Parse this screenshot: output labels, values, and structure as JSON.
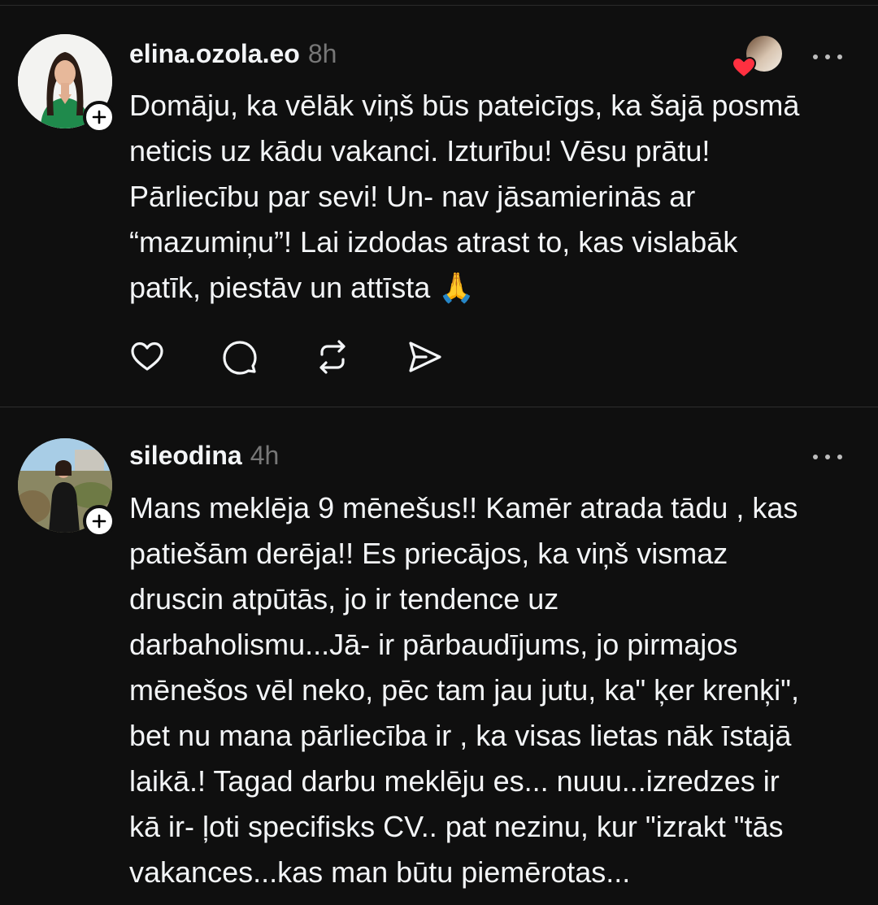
{
  "posts": [
    {
      "username": "elina.ozola.eo",
      "time": "8h",
      "lines": [
        "Domāju, ka vēlāk viņš būs pateicīgs, ka šajā posmā",
        "neticis uz kādu vakanci. Izturību! Vēsu prātu!",
        "Pārliecību par sevi! Un- nav jāsamierinās ar",
        "“mazumiņu”! Lai izdodas atrast to, kas vislabāk",
        "patīk, piestāv un attīsta 🙏"
      ]
    },
    {
      "username": "sileodina",
      "time": "4h",
      "lines": [
        "Mans meklēja 9 mēnešus!! Kamēr atrada tādu , kas",
        "patiešām derēja!! Es priecājos, ka viņš vismaz",
        "druscin atpūtās, jo ir tendence uz",
        "darbaholismu...Jā- ir pārbaudījums, jo pirmajos",
        "mēnešos vēl neko, pēc tam jau jutu, ka\" ķer krenķi\",",
        "bet nu mana pārliecība ir , ka visas lietas nāk īstajā",
        "laikā.! Tagad darbu meklēju es... nuuu...izredzes ir",
        "kā ir- ļoti specifisks CV.. pat nezinu, kur \"izrakt \"tās",
        "vakances...kas man būtu piemērotas..."
      ]
    }
  ],
  "icons": {
    "like": "heart-icon",
    "reply": "comment-icon",
    "repost": "repost-icon",
    "share": "send-icon",
    "follow": "plus-icon",
    "more": "more-icon"
  },
  "colors": {
    "background": "#0f0f0f",
    "text": "#f3f5f7",
    "muted": "#777777",
    "heart": "#ff3040"
  }
}
